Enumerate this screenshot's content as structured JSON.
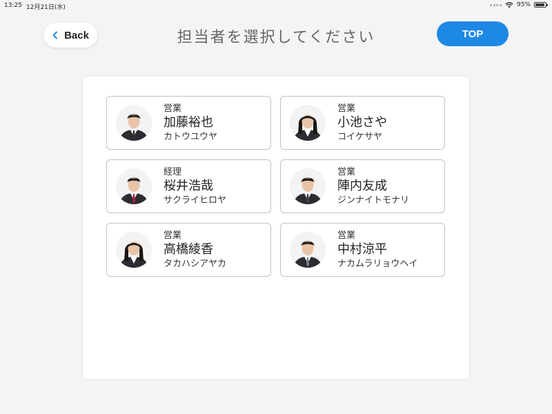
{
  "status_bar": {
    "time": "13:25",
    "date": "12月21日(水)",
    "battery": "95%",
    "battery_level": 0.95
  },
  "header": {
    "back_label": "Back",
    "title": "担当者を選択してください",
    "top_label": "TOP"
  },
  "colors": {
    "accent": "#1e88e5",
    "background": "#f4f4f4",
    "card_border": "#c2c2c2"
  },
  "staff": [
    {
      "role": "営業",
      "name": "加藤裕也",
      "kana": "カトウユウヤ",
      "tie": "#333333",
      "hair": "#2a2420"
    },
    {
      "role": "営業",
      "name": "小池さや",
      "kana": "コイケサヤ",
      "tie": "",
      "hair": "#1a1614"
    },
    {
      "role": "経理",
      "name": "桜井浩哉",
      "kana": "サクライヒロヤ",
      "tie": "#b0203a",
      "hair": "#1c1816"
    },
    {
      "role": "営業",
      "name": "陣内友成",
      "kana": "ジンナイトモナリ",
      "tie": "#444444",
      "hair": "#1a1512"
    },
    {
      "role": "営業",
      "name": "高橋綾香",
      "kana": "タカハシアヤカ",
      "tie": "",
      "hair": "#1b1512"
    },
    {
      "role": "営業",
      "name": "中村涼平",
      "kana": "ナカムラリョウヘイ",
      "tie": "#7a7f8a",
      "hair": "#241c18"
    }
  ]
}
